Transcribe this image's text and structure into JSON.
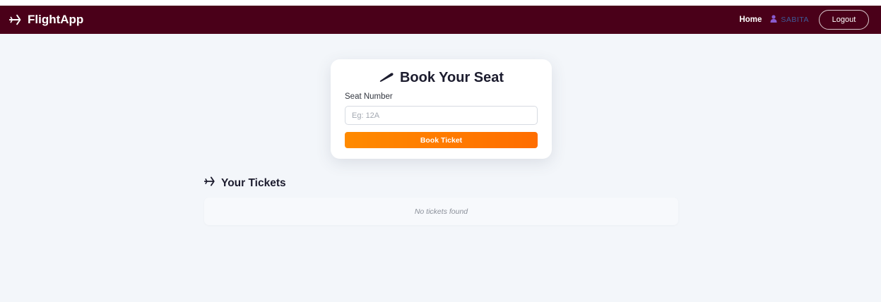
{
  "navbar": {
    "brand": "FlightApp",
    "brand_icon": "plane-icon",
    "home_label": "Home",
    "user_icon": "user-icon",
    "username": "SABITA",
    "logout_label": "Logout",
    "bg_color": "#4a0019"
  },
  "booking": {
    "title": "Book Your Seat",
    "title_icon": "ticket-icon",
    "seat_label": "Seat Number",
    "seat_placeholder": "Eg: 12A",
    "seat_value": "",
    "submit_label": "Book Ticket",
    "accent_color": "#ff7a00"
  },
  "tickets": {
    "heading": "Your Tickets",
    "heading_icon": "plane-icon",
    "empty_message": "No tickets found"
  }
}
